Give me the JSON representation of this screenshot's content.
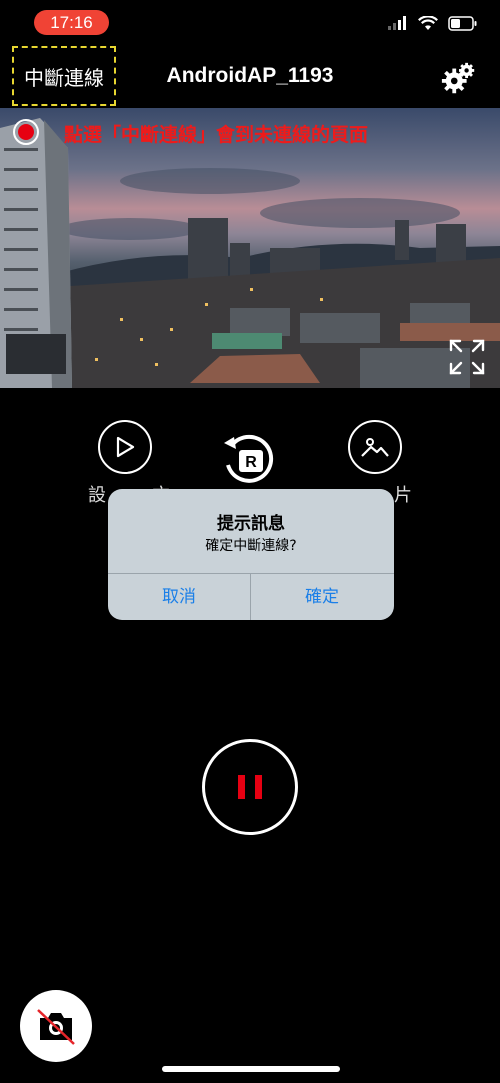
{
  "status_bar": {
    "time": "17:16",
    "time_pill_color": "#f04335"
  },
  "header": {
    "disconnect_label": "中斷連線",
    "title": "AndroidAP_1193",
    "settings_icon": "gear-icon"
  },
  "preview": {
    "annotation": "點選「中斷連線」會到未連線的頁面",
    "annotation_color": "#ee1b1b",
    "record_indicator_color": "#e60012",
    "fullscreen_icon": "expand-icon"
  },
  "modes": {
    "left_label": "設",
    "left_label_tail": "方",
    "right_label_tail": "片",
    "center_icon": "rotate-r-icon"
  },
  "dialog": {
    "title": "提示訊息",
    "message": "確定中斷連線?",
    "cancel_label": "取消",
    "confirm_label": "確定",
    "button_color": "#1a7fe8"
  },
  "controls": {
    "shutter_icon": "pause-icon",
    "camera_toggle_icon": "camera-off-icon"
  }
}
